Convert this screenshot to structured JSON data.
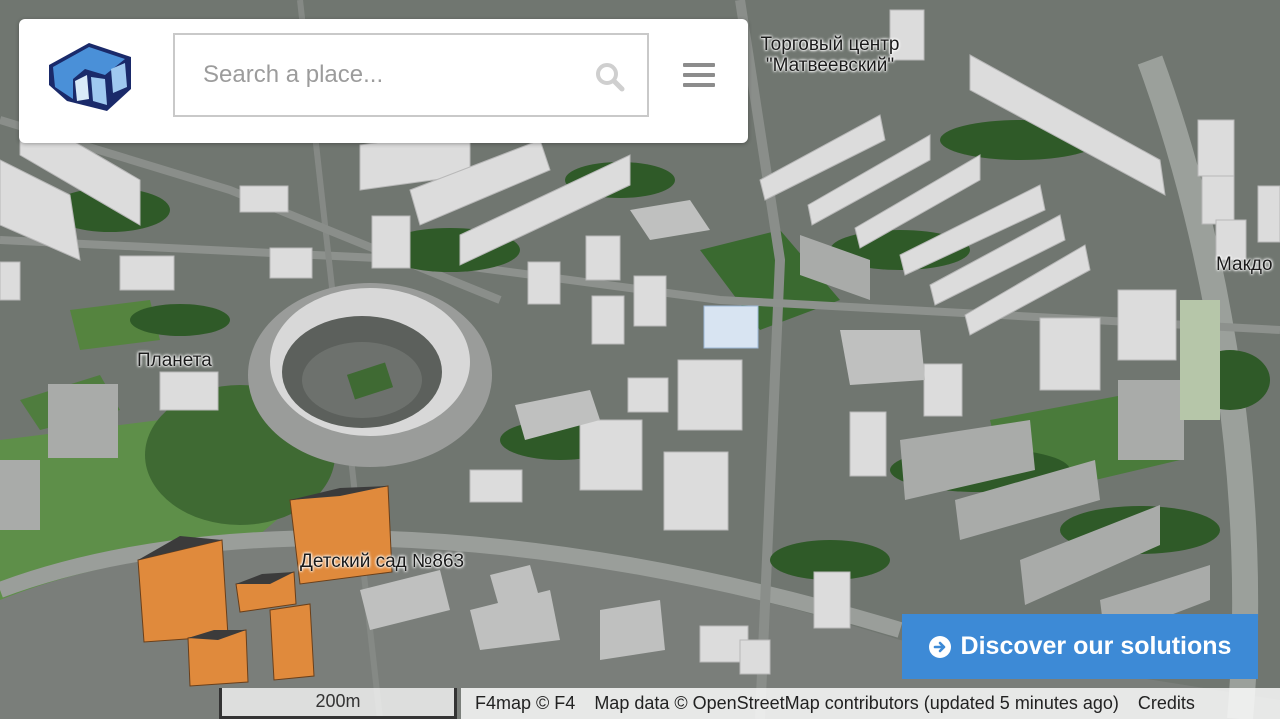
{
  "search": {
    "placeholder": "Search a place..."
  },
  "map": {
    "labels": [
      "Торговый центр",
      "\"Матвеевский\"",
      "Планета",
      "Детский сад №863",
      "Макдо"
    ]
  },
  "discover_button": {
    "label": "Discover our solutions"
  },
  "scale": {
    "label": "200m"
  },
  "attribution": {
    "f4map": "F4map © F4",
    "map_data": "Map data © OpenStreetMap contributors (updated 5 minutes ago)",
    "credits": "Credits"
  },
  "colors": {
    "accent_blue": "#3d8ad6",
    "highlighted_building": "#e08a3c",
    "grass": "#5e8a4a"
  },
  "icons": [
    "f4map-logo-icon",
    "search-icon",
    "hamburger-menu-icon",
    "arrow-circle-right-icon"
  ]
}
